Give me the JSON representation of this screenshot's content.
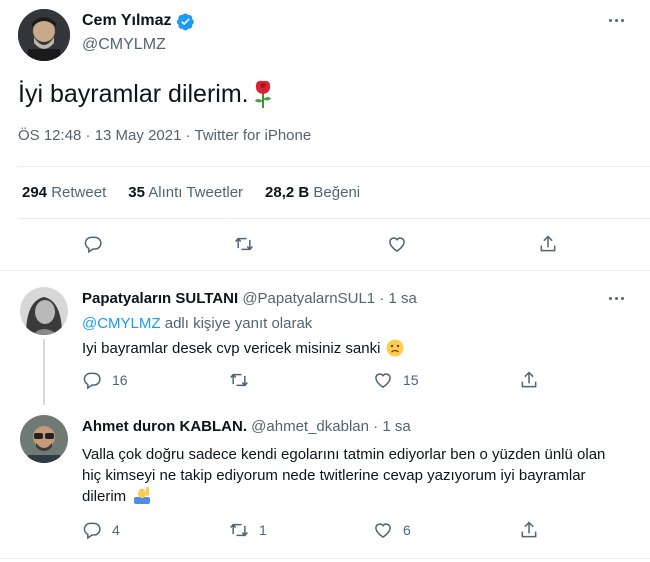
{
  "main_tweet": {
    "author_name": "Cem Yılmaz",
    "handle": "@CMYLMZ",
    "text": "İyi bayramlar dilerim.",
    "emoji": "🌹",
    "meta": "ÖS 12:48 · 13 May 2021 · Twitter for iPhone",
    "stats": {
      "retweets_count": "294",
      "retweets_label": "Retweet",
      "quotes_count": "35",
      "quotes_label": "Alıntı Tweetler",
      "likes_count": "28,2 B",
      "likes_label": "Beğeni"
    }
  },
  "replies": [
    {
      "author_name": "Papatyaların SULTANI",
      "handle": "@PapatyalarnSUL1",
      "time": "1 sa",
      "replying_to_handle": "@CMYLMZ",
      "replying_to_suffix": "adlı kişiye yanıt olarak",
      "text": "Iyi bayramlar desek cvp vericek misiniz sanki",
      "emoji": "🙁",
      "reply_count": "16",
      "retweet_count": "",
      "like_count": "15"
    },
    {
      "author_name": "Ahmet duron KABLAN.",
      "handle": "@ahmet_dkablan",
      "time": "1 sa",
      "text": "Valla çok doğru sadece kendi egolarını tatmin ediyorlar ben o yüzden ünlü olan hiç kimseyi ne takip ediyorum nede twitlerine cevap yazıyorum iyi bayramlar dilerim",
      "emoji": "🙋",
      "reply_count": "4",
      "retweet_count": "1",
      "like_count": "6"
    }
  ],
  "colors": {
    "accent": "#1d9bf0",
    "text": "#0f1419",
    "muted": "#536471",
    "border": "#e6ecf0",
    "rose": "#d9232d"
  },
  "icons": [
    "verified-badge-icon",
    "more-icon",
    "reply-icon",
    "retweet-icon",
    "like-icon",
    "share-icon"
  ]
}
